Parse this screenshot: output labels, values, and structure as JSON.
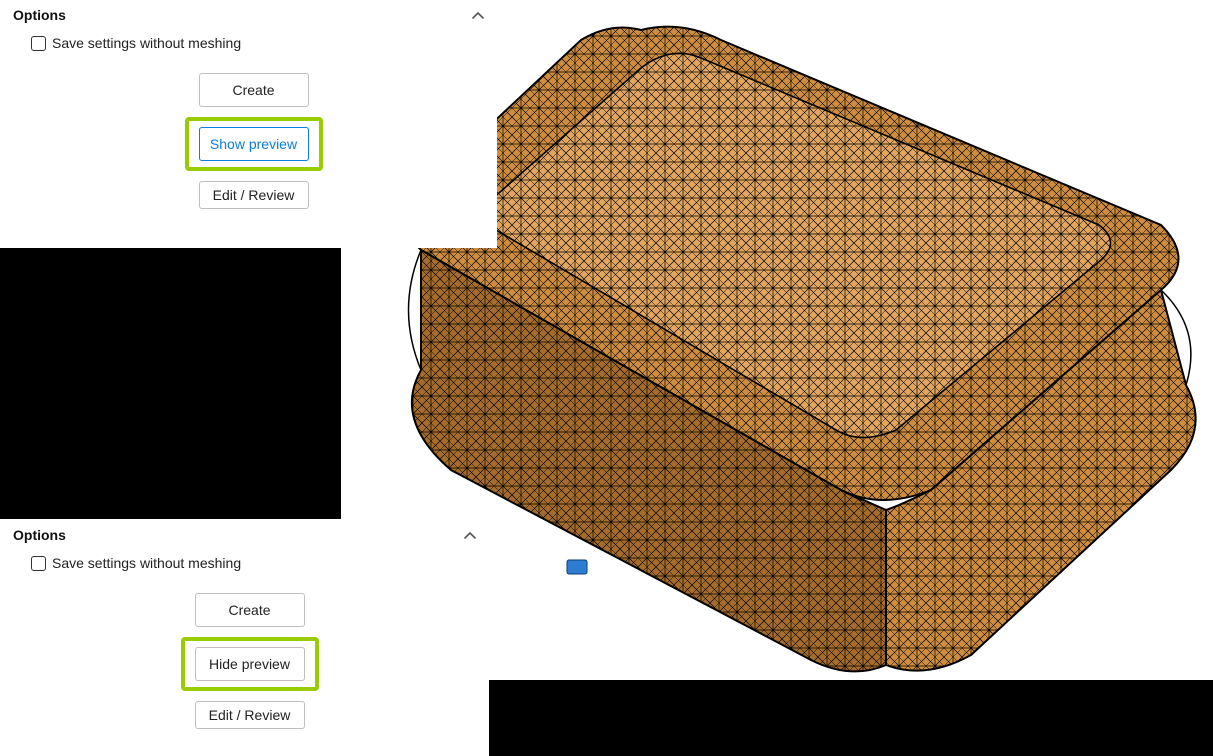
{
  "panels": {
    "top": {
      "title": "Options",
      "checkbox_label": "Save settings without meshing",
      "buttons": {
        "create": "Create",
        "preview": "Show preview",
        "edit": "Edit / Review"
      }
    },
    "bottom": {
      "title": "Options",
      "checkbox_label": "Save settings without meshing",
      "buttons": {
        "create": "Create",
        "preview": "Hide preview",
        "edit": "Edit / Review"
      }
    }
  },
  "colors": {
    "highlight": "#99cc00",
    "primary_outline": "#0a7de0",
    "mesh_fill": "#cf8d3f",
    "mesh_edge": "#000000"
  },
  "viewport": {
    "description": "Isometric finite-element triangular surface mesh preview of a rounded rectangular cushion-like solid",
    "probe_color": "#2d7dd2"
  }
}
